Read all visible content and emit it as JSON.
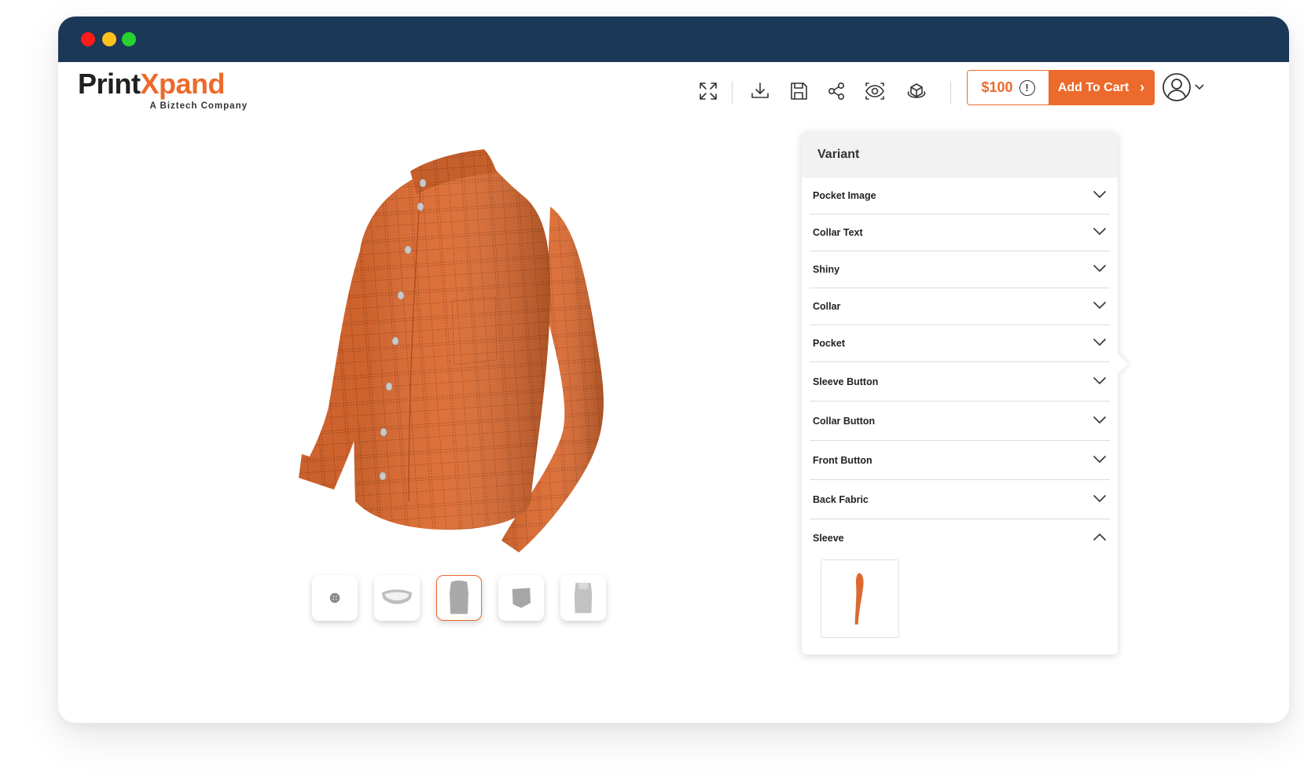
{
  "app": {
    "logo_part1": "Print",
    "logo_part2": "Xpand",
    "logo_tagline": "A Biztech Company"
  },
  "toolbar": {
    "icons": [
      "fullscreen-icon",
      "download-icon",
      "save-icon",
      "share-icon",
      "preview-eye-icon",
      "3d-view-icon"
    ]
  },
  "cart": {
    "price": "$100",
    "info_glyph": "!",
    "add_label": "Add To Cart",
    "chevron": "›"
  },
  "colors": {
    "brand": "#ec6a2c",
    "titlebar": "#1c3857",
    "fabric": "#d9672f"
  },
  "thumbnails": [
    {
      "name": "button-part",
      "active": false
    },
    {
      "name": "collar-part",
      "active": false
    },
    {
      "name": "front-body-part",
      "active": true
    },
    {
      "name": "pocket-part",
      "active": false
    },
    {
      "name": "back-body-part",
      "active": false
    }
  ],
  "panel": {
    "title": "Variant",
    "items": [
      {
        "label": "Pocket Image",
        "expanded": false
      },
      {
        "label": "Collar Text",
        "expanded": false
      },
      {
        "label": "Shiny",
        "expanded": false
      },
      {
        "label": "Collar",
        "expanded": false
      },
      {
        "label": "Pocket",
        "expanded": false
      },
      {
        "label": "Sleeve Button",
        "expanded": false
      },
      {
        "label": "Collar Button",
        "expanded": false
      },
      {
        "label": "Front Button",
        "expanded": false
      },
      {
        "label": "Back Fabric",
        "expanded": false
      },
      {
        "label": "Sleeve",
        "expanded": true
      }
    ]
  }
}
